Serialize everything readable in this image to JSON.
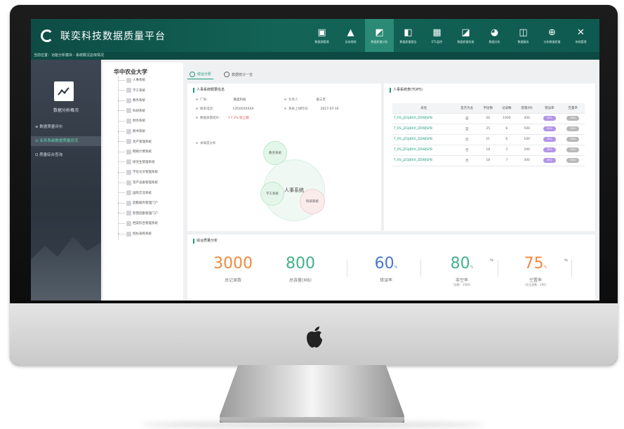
{
  "app": {
    "title": "联奕科技数据质量平台",
    "breadcrumb": "当前位置：功能分析模块 - 系统概况总体情况"
  },
  "nav": [
    {
      "label": "数据源管理",
      "icon": "▣",
      "icon_name": "monitor-icon",
      "active": false
    },
    {
      "label": "业务规则",
      "icon": "▲",
      "icon_name": "warning-icon",
      "active": false
    },
    {
      "label": "数据质量分析",
      "icon": "◩",
      "icon_name": "chart-box-icon",
      "active": true
    },
    {
      "label": "数据质量报告",
      "icon": "◧",
      "icon_name": "report-icon",
      "active": false
    },
    {
      "label": "ETL监控",
      "icon": "▦",
      "icon_name": "grid-icon",
      "active": false
    },
    {
      "label": "数据质量检查",
      "icon": "◪",
      "icon_name": "check-chart-icon",
      "active": false
    },
    {
      "label": "数据分析",
      "icon": "◕",
      "icon_name": "pie-icon",
      "active": false
    },
    {
      "label": "数据服务",
      "icon": "◫",
      "icon_name": "service-icon",
      "active": false
    },
    {
      "label": "分析数据质量",
      "icon": "⊕",
      "icon_name": "search-data-icon",
      "active": false
    },
    {
      "label": "系统管理",
      "icon": "✕",
      "icon_name": "tools-icon",
      "active": false
    }
  ],
  "sidebar": {
    "title": "数据分析概况",
    "items": [
      {
        "label": "≡  数据质量评价",
        "active": false
      },
      {
        "label": "⊙  业务系统数据质量状况",
        "active": true
      },
      {
        "label": "Q  质量综合查询",
        "active": false
      }
    ]
  },
  "tree": {
    "root": "华中农业大学",
    "nodes": [
      "人事系统",
      "学工系统",
      "教务系统",
      "科研系统",
      "财务系统",
      "图书系统",
      "资产管理系统",
      "网络计费系统",
      "研究生管理系统",
      "学位论文管理系统",
      "资产设备管理系统",
      "国际交流系统",
      "后勤服务管理门户",
      "智慧后勤管理门户",
      "档案综合管理系统",
      "招标采购系统"
    ]
  },
  "tabs": [
    {
      "label": "综合分析",
      "active": true
    },
    {
      "label": "数据统计一览",
      "active": false
    }
  ],
  "overview": {
    "title": "人事系统概要信息",
    "fields": [
      {
        "label": "厂商：",
        "value": "联奕科技",
        "red": false
      },
      {
        "label": "负责人",
        "value": "张三丰",
        "red": false
      },
      {
        "label": "联系电话：",
        "value": "135XXXXXXX",
        "red": false
      },
      {
        "label": "系统上线时间：",
        "value": "2017-07-16",
        "red": false
      },
      {
        "label": "数据质量提升：",
        "value": "↑7.1%  较上期",
        "red": true
      }
    ],
    "relation_label": "关联度分析",
    "bubbles": [
      {
        "label": "人事系统",
        "kind": "main"
      },
      {
        "label": "教务系统",
        "kind": "green"
      },
      {
        "label": "学工系统",
        "kind": "green"
      },
      {
        "label": "科研系统",
        "kind": "pink"
      }
    ]
  },
  "top_tables": {
    "title": "人事系统表(TOP5)",
    "headers": [
      "表名",
      "是否为主",
      "字段数",
      "记录数",
      "容量(M)",
      "错误率",
      "空置率"
    ],
    "rows": [
      {
        "name": "T_RS_JZGJBXX_ZDWJSPB",
        "primary": "是",
        "fields": "20",
        "records": "1000",
        "size": "400",
        "error": "30%",
        "empty": "30%"
      },
      {
        "name": "T_RS_JZGJBXX_ZDWJSPB",
        "primary": "是",
        "fields": "25",
        "records": "8",
        "size": "500",
        "error": "30%",
        "empty": "30%"
      },
      {
        "name": "T_RS_JZGJBXX_ZDWJSPB",
        "primary": "否",
        "fields": "21",
        "records": "6",
        "size": "100",
        "error": "30%",
        "empty": "30%"
      },
      {
        "name": "T_RS_JZGJBXX_ZDWJSPB",
        "primary": "否",
        "fields": "18",
        "records": "3",
        "size": "200",
        "error": "30%",
        "empty": "30%"
      },
      {
        "name": "T_RS_JZGJBXX_ZDWJSPB",
        "primary": "否",
        "fields": "18",
        "records": "7",
        "size": "300",
        "error": "30%",
        "empty": "30%"
      }
    ]
  },
  "quality": {
    "title": "综合质量分析",
    "stats": [
      {
        "value": "3000",
        "unit": "",
        "label": "总记录数",
        "note": "",
        "color": "#f08a3c"
      },
      {
        "value": "800",
        "unit": "",
        "label": "总容量(MB)",
        "note": "",
        "color": "#43b28b"
      },
      {
        "value": "60",
        "unit": "%",
        "label": "错误率",
        "note": "",
        "color": "#4a77d4"
      },
      {
        "value": "80",
        "unit": "%",
        "label": "非空率",
        "note": "（总数：1000）",
        "color": "#43b28b"
      },
      {
        "value": "75",
        "unit": "%",
        "label": "空置率",
        "note": "（空记录数：200）",
        "color": "#f08a3c"
      }
    ]
  },
  "colors": {
    "brand": "#136457",
    "accent": "#1a9c7e"
  }
}
